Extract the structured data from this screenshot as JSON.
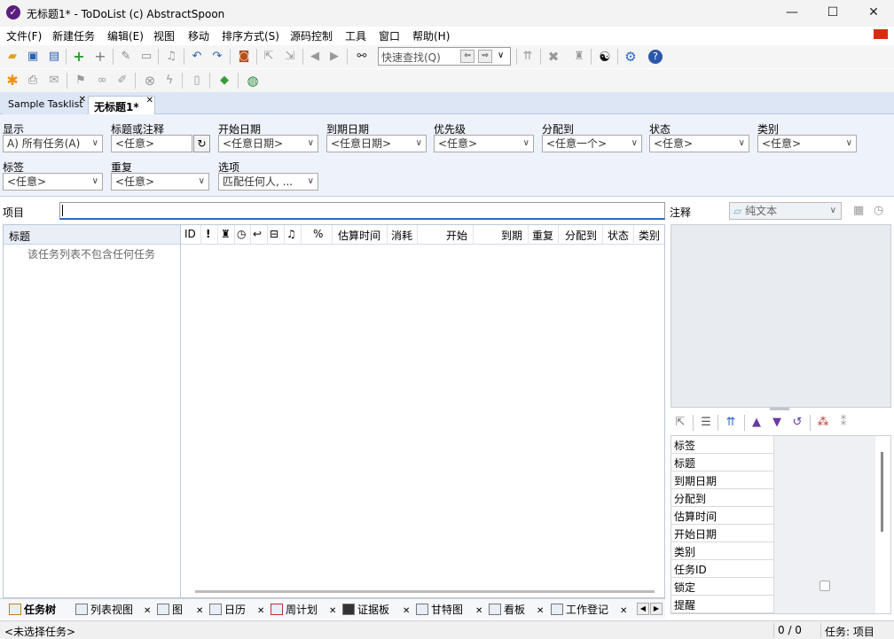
{
  "window": {
    "title": "无标题1* - ToDoList (c) AbstractSpoon",
    "controls": [
      "—",
      "☐",
      "✕"
    ]
  },
  "menu": [
    "文件(F)",
    "新建任务",
    "编辑(E)",
    "视图",
    "移动",
    "排序方式(S)",
    "源码控制",
    "工具",
    "窗口",
    "帮助(H)"
  ],
  "quick_find": {
    "placeholder": "快速查找(Q)"
  },
  "doc_tabs": [
    {
      "label": "Sample Tasklist",
      "active": false
    },
    {
      "label": "无标题1*",
      "active": true
    }
  ],
  "filters": {
    "row1": [
      {
        "label": "显示",
        "value": "A)  所有任务(A)"
      },
      {
        "label": "标题或注释",
        "value": "<任意>"
      },
      {
        "label": "开始日期",
        "value": "<任意日期>"
      },
      {
        "label": "到期日期",
        "value": "<任意日期>"
      },
      {
        "label": "优先级",
        "value": "<任意>"
      },
      {
        "label": "分配到",
        "value": "<任意一个>"
      },
      {
        "label": "状态",
        "value": "<任意>"
      },
      {
        "label": "类别",
        "value": "<任意>"
      }
    ],
    "row2": [
      {
        "label": "标签",
        "value": "<任意>"
      },
      {
        "label": "重复",
        "value": "<任意>"
      },
      {
        "label": "选项",
        "value": "匹配任何人, ..."
      }
    ]
  },
  "item_label": "项目",
  "notes": {
    "label": "注释",
    "format": "纯文本"
  },
  "tree": {
    "header": "标题",
    "empty_message": "该任务列表不包含任何任务"
  },
  "columns": [
    "ID",
    "!",
    "%",
    "估算时间",
    "消耗",
    "开始",
    "到期",
    "重复",
    "分配到",
    "状态",
    "类别"
  ],
  "view_tabs": [
    "任务树",
    "列表视图",
    "图",
    "日历",
    "周计划",
    "证据板",
    "甘特图",
    "看板",
    "工作登记"
  ],
  "attributes": [
    "标签",
    "标题",
    "到期日期",
    "分配到",
    "估算时间",
    "开始日期",
    "类别",
    "任务ID",
    "锁定",
    "提醒"
  ],
  "status": {
    "selection": "<未选择任务>",
    "count": "0 / 0",
    "focus": "任务: 项目"
  },
  "colors": {
    "flag": "#de2910",
    "accent": "#2a68c8",
    "app_icon": "#5b1e7e"
  }
}
